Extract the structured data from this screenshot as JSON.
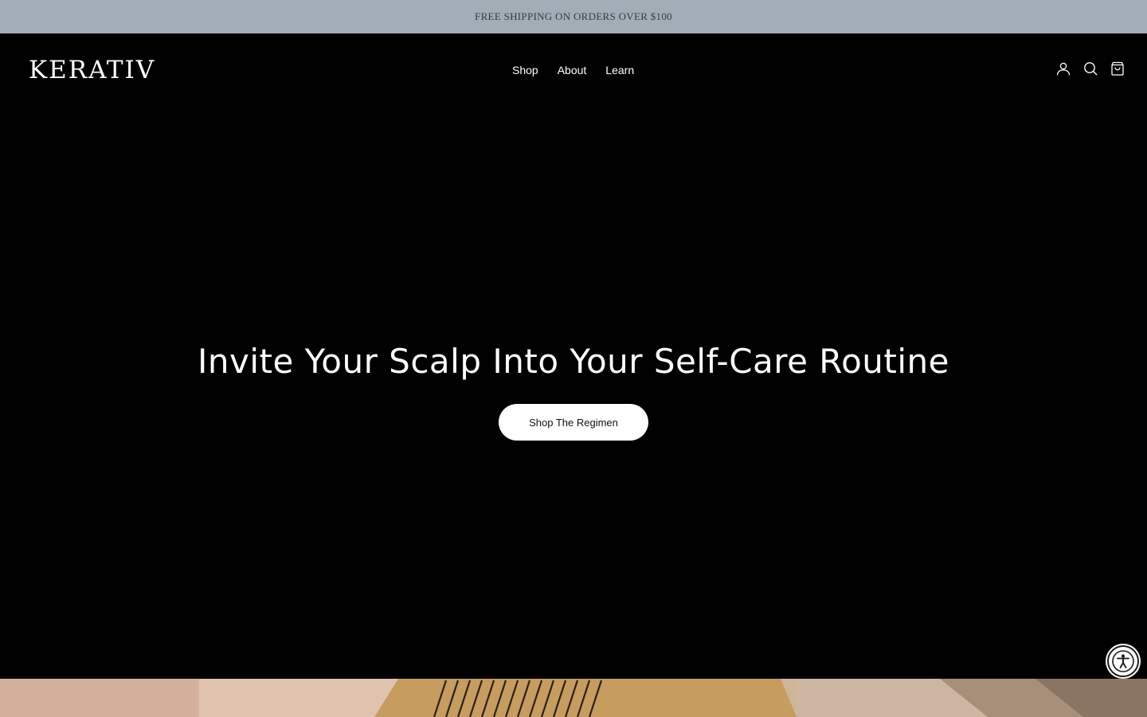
{
  "announcement": {
    "text": "FREE SHIPPING ON ORDERS OVER $100"
  },
  "header": {
    "logo": "KERATIV",
    "nav": [
      {
        "label": "Shop"
      },
      {
        "label": "About"
      },
      {
        "label": "Learn"
      }
    ],
    "icons": [
      "account-icon",
      "search-icon",
      "cart-icon"
    ]
  },
  "hero": {
    "title": "Invite Your Scalp Into Your Self-Care Routine",
    "cta_label": "Shop The Regimen"
  },
  "accessibility": {
    "icon": "accessibility-icon"
  },
  "colors": {
    "announcement_bg": "#a3adb8",
    "announcement_text": "#3a3a3a",
    "page_bg": "#000000",
    "button_bg": "#ffffff",
    "button_text": "#111111"
  }
}
